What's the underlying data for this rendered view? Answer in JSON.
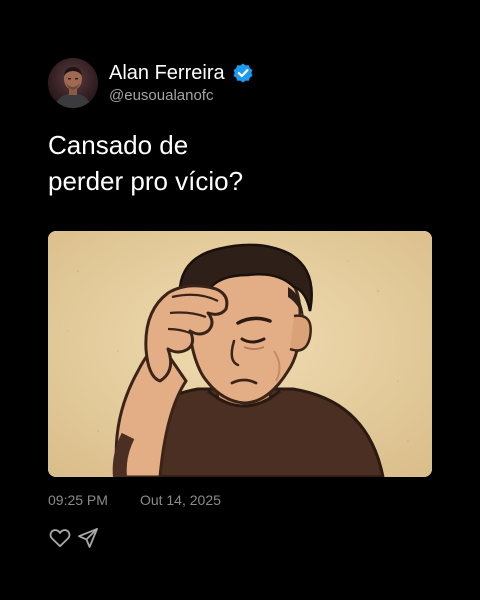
{
  "author": {
    "display_name": "Alan Ferreira",
    "handle": "@eusoualanofc",
    "verified": true,
    "verified_color": "#1d9bf0"
  },
  "tweet": {
    "text_lines": [
      "Cansado de",
      "perder pro vício?"
    ],
    "media_description": "illustration-man-holding-head-sad"
  },
  "meta": {
    "time": "09:25 PM",
    "date": "Out 14, 2025"
  },
  "actions": {
    "like_icon": "heart-icon",
    "share_icon": "send-icon"
  },
  "colors": {
    "background": "#000000",
    "text": "#ffffff",
    "muted": "#8a8a8a"
  }
}
